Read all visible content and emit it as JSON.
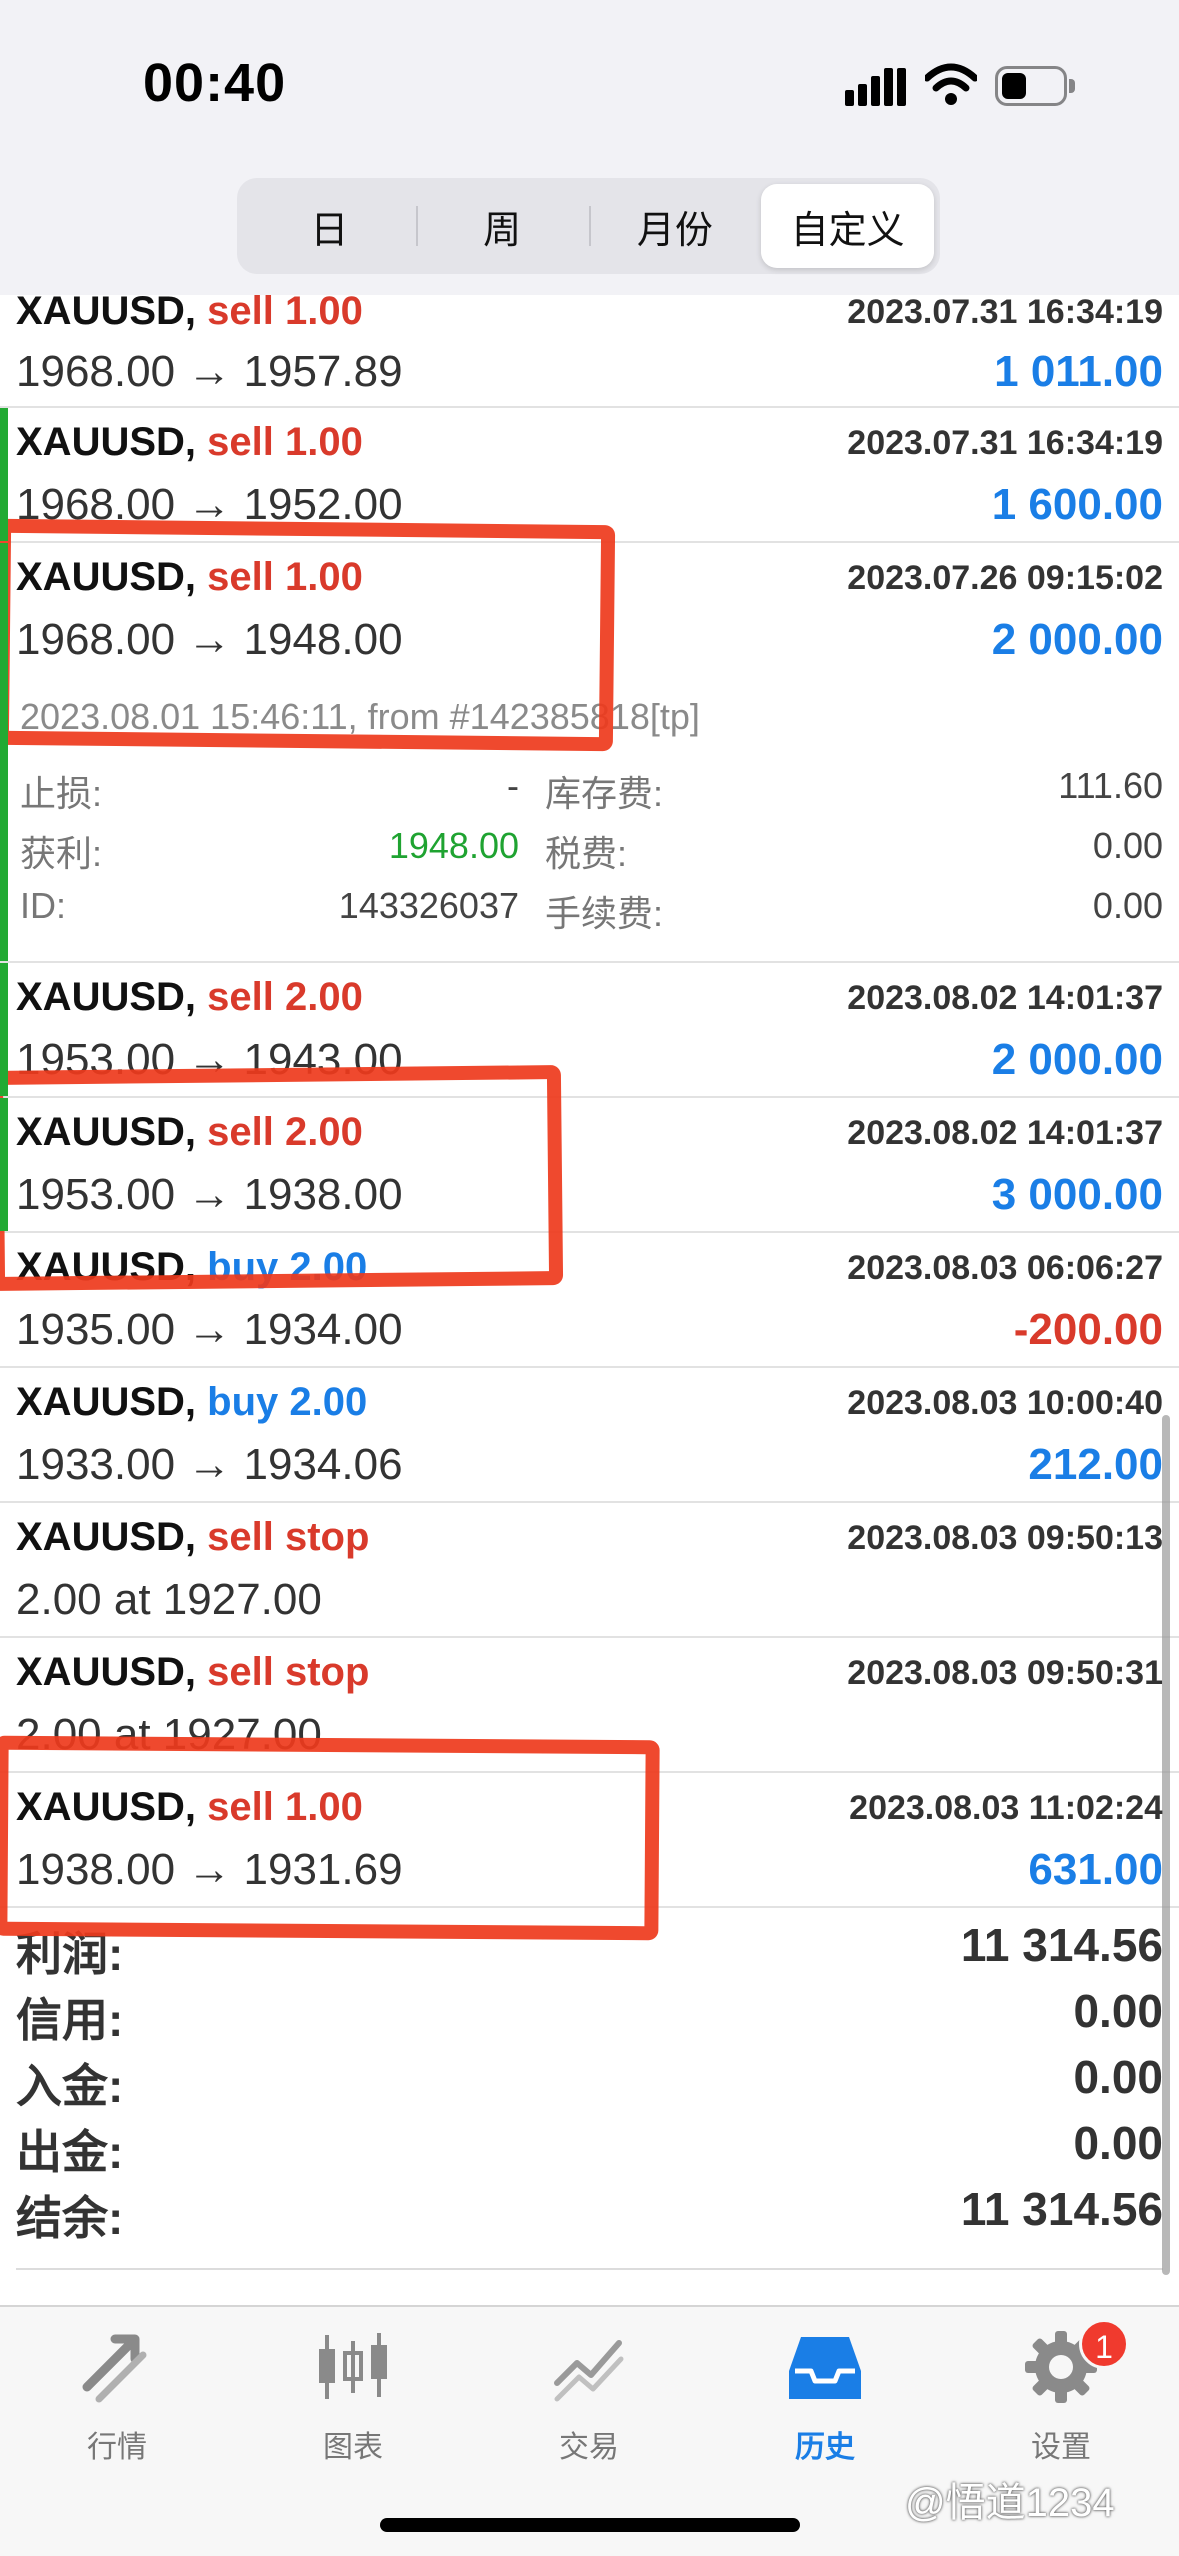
{
  "status_bar": {
    "time": "00:40"
  },
  "period_tabs": [
    {
      "label": "日",
      "active": false
    },
    {
      "label": "周",
      "active": false
    },
    {
      "label": "月份",
      "active": false
    },
    {
      "label": "自定义",
      "active": true
    }
  ],
  "deals": [
    {
      "symbol": "XAUUSD,",
      "type": "sell 1.00",
      "direction": "sell",
      "time": "2023.07.31 16:34:19",
      "prices": "1968.00 → 1957.89",
      "profit": "1 011.00",
      "profit_sign": "pos"
    },
    {
      "symbol": "XAUUSD,",
      "type": "sell 1.00",
      "direction": "sell",
      "time": "2023.07.31 16:34:19",
      "prices": "1968.00 → 1952.00",
      "profit": "1 600.00",
      "profit_sign": "pos"
    },
    {
      "symbol": "XAUUSD,",
      "type": "sell 1.00",
      "direction": "sell",
      "time": "2023.07.26 09:15:02",
      "prices": "1968.00 → 1948.00",
      "profit": "2 000.00",
      "profit_sign": "pos",
      "meta": "2023.08.01 15:46:11, from #142385818[tp]",
      "details": {
        "sl_label": "止损:",
        "sl_value": "-",
        "swap_label": "库存费:",
        "swap_value": "111.60",
        "tp_label": "获利:",
        "tp_value": "1948.00",
        "tax_label": "税费:",
        "tax_value": "0.00",
        "id_label": "ID:",
        "id_value": "143326037",
        "fee_label": "手续费:",
        "fee_value": "0.00"
      }
    },
    {
      "symbol": "XAUUSD,",
      "type": "sell 2.00",
      "direction": "sell",
      "time": "2023.08.02 14:01:37",
      "prices": "1953.00 → 1943.00",
      "profit": "2 000.00",
      "profit_sign": "pos"
    },
    {
      "symbol": "XAUUSD,",
      "type": "sell 2.00",
      "direction": "sell",
      "time": "2023.08.02 14:01:37",
      "prices": "1953.00 → 1938.00",
      "profit": "3 000.00",
      "profit_sign": "pos"
    },
    {
      "symbol": "XAUUSD,",
      "type": "buy 2.00",
      "direction": "buy",
      "time": "2023.08.03 06:06:27",
      "prices": "1935.00 → 1934.00",
      "profit": "-200.00",
      "profit_sign": "neg"
    },
    {
      "symbol": "XAUUSD,",
      "type": "buy 2.00",
      "direction": "buy",
      "time": "2023.08.03 10:00:40",
      "prices": "1933.00 → 1934.06",
      "profit": "212.00",
      "profit_sign": "pos"
    },
    {
      "symbol": "XAUUSD,",
      "type": "sell stop",
      "direction": "sell",
      "time": "2023.08.03 09:50:13",
      "prices": "2.00 at 1927.00",
      "profit": "",
      "profit_sign": "pos"
    },
    {
      "symbol": "XAUUSD,",
      "type": "sell stop",
      "direction": "sell",
      "time": "2023.08.03 09:50:31",
      "prices": "2.00 at 1927.00",
      "profit": "",
      "profit_sign": "pos"
    },
    {
      "symbol": "XAUUSD,",
      "type": "sell 1.00",
      "direction": "sell",
      "time": "2023.08.03 11:02:24",
      "prices": "1938.00 → 1931.69",
      "profit": "631.00",
      "profit_sign": "pos"
    }
  ],
  "summary": [
    {
      "label": "利润:",
      "value": "11 314.56"
    },
    {
      "label": "信用:",
      "value": "0.00"
    },
    {
      "label": "入金:",
      "value": "0.00"
    },
    {
      "label": "出金:",
      "value": "0.00"
    },
    {
      "label": "结余:",
      "value": "11 314.56"
    }
  ],
  "tab_bar": [
    {
      "label": "行情",
      "icon": "quotes-arrows-icon",
      "active": false
    },
    {
      "label": "图表",
      "icon": "candlestick-chart-icon",
      "active": false
    },
    {
      "label": "交易",
      "icon": "trade-chart-icon",
      "active": false
    },
    {
      "label": "历史",
      "icon": "history-inbox-icon",
      "active": true
    },
    {
      "label": "设置",
      "icon": "gear-icon",
      "active": false,
      "badge": "1"
    }
  ],
  "watermark": "@悟道1234",
  "colors": {
    "sell": "#d93a2b",
    "buy": "#1a7ee6",
    "profit_positive": "#1a7ee6",
    "profit_negative": "#d93a2b",
    "active_tab": "#1a7ee6",
    "highlight_marker": "#ee3a1c"
  }
}
